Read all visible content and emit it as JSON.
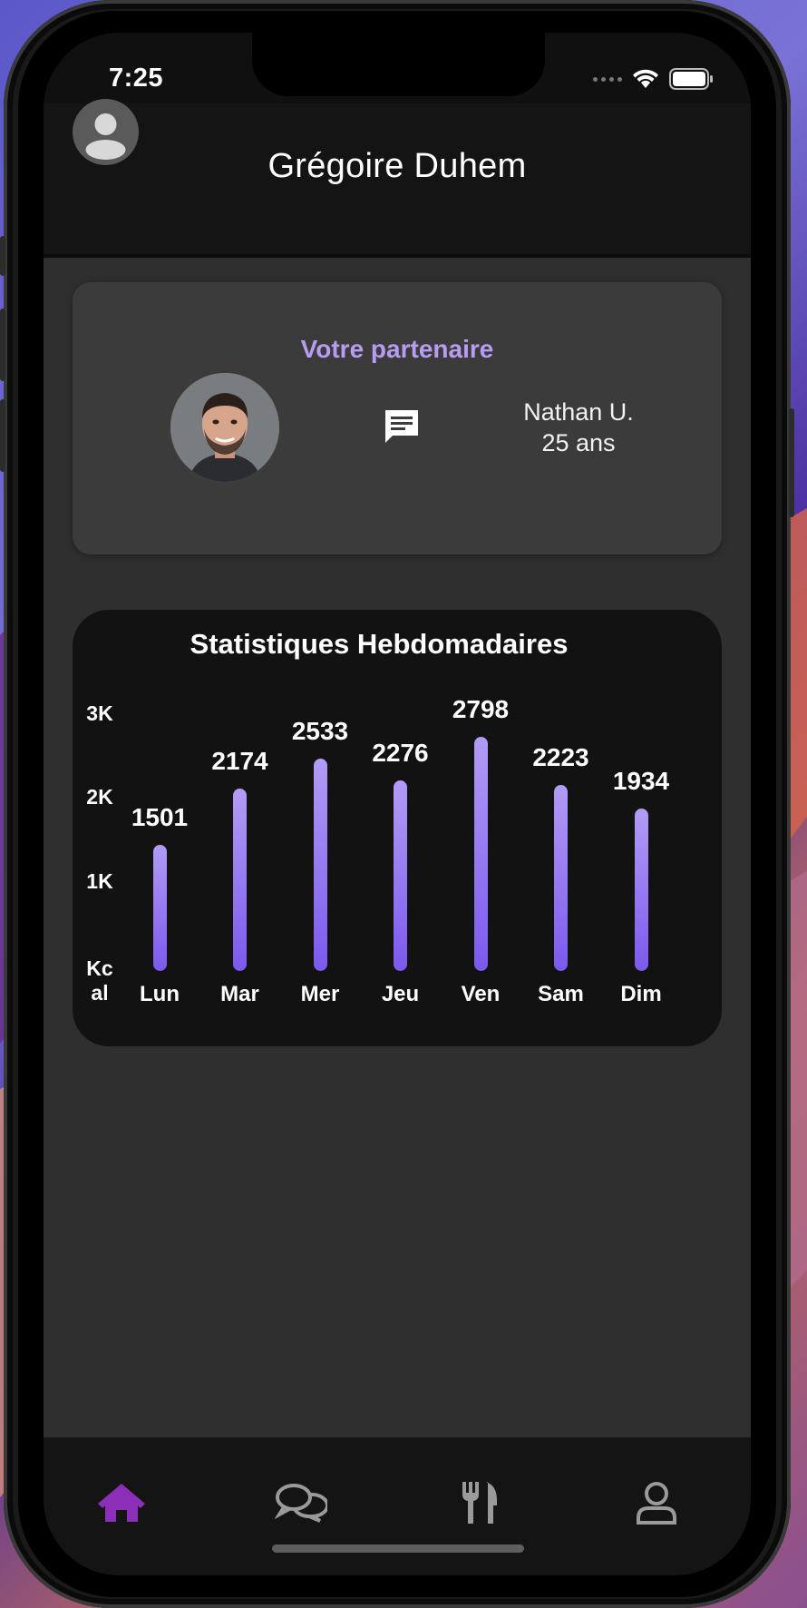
{
  "status_bar": {
    "time": "7:25"
  },
  "header": {
    "title": "Grégoire Duhem"
  },
  "partner_card": {
    "heading": "Votre partenaire",
    "name": "Nathan U.",
    "age": "25 ans"
  },
  "colors": {
    "accent": "#b79cf2",
    "bar_bottom": "#7b59ee",
    "bar_top": "#b29cf5",
    "tab_active": "#8b2fb8",
    "tab_inactive": "#9a9a9a"
  },
  "chart_data": {
    "type": "bar",
    "title": "Statistiques Hebdomadaires",
    "ylabel": "Kc\nal",
    "y_ticks": [
      "1K",
      "2K",
      "3K"
    ],
    "ylim": [
      0,
      3000
    ],
    "categories": [
      "Lun",
      "Mar",
      "Mer",
      "Jeu",
      "Ven",
      "Sam",
      "Dim"
    ],
    "values": [
      1501,
      2174,
      2533,
      2276,
      2798,
      2223,
      1934
    ],
    "value_labels": [
      "1501",
      "2174",
      "2533",
      "2276",
      "2798",
      "2223",
      "1934"
    ],
    "grid": false,
    "legend": "none"
  },
  "tabbar": {
    "tabs": [
      {
        "icon": "home-icon",
        "active": true
      },
      {
        "icon": "chat-bubbles-icon",
        "active": false
      },
      {
        "icon": "fork-knife-icon",
        "active": false
      },
      {
        "icon": "profile-icon",
        "active": false
      }
    ]
  }
}
